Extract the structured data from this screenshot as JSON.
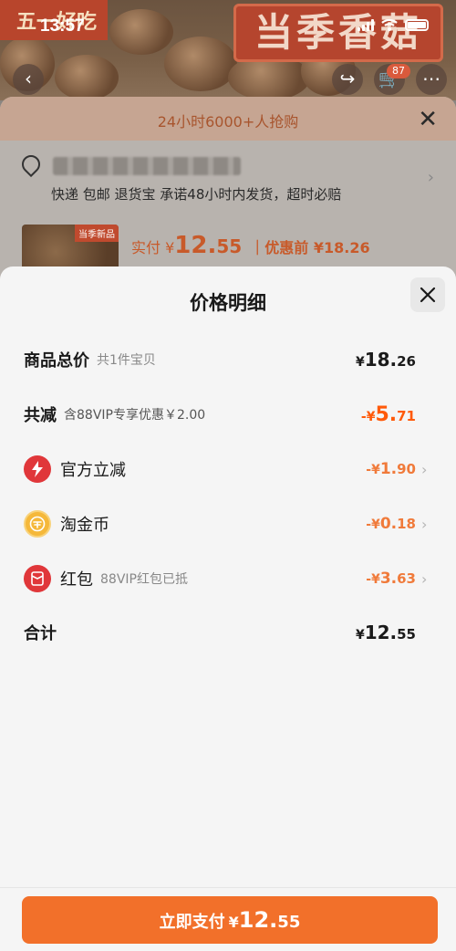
{
  "status": {
    "time": "13:57"
  },
  "background": {
    "banner_left": "五一好吃",
    "banner_right": "当季香菇",
    "cart_badge": "87",
    "hot_text": "24小时6000+人抢购",
    "shipping_text": "快递 包邮 退货宝 承诺48小时内发货，超时必赔",
    "thumb_tag": "当季新品",
    "price_label": "实付 ¥",
    "price_int": "12.",
    "price_dec": "55",
    "before_label": "｜优惠前 ¥18.26"
  },
  "sheet": {
    "title": "价格明细",
    "rows": [
      {
        "label": "商品总价",
        "sub": "共1件宝贝",
        "currency": "¥",
        "int": "18.",
        "dec": "26"
      },
      {
        "label": "共减",
        "sub": "含88VIP专享优惠￥2.00",
        "currency": "-¥",
        "int": "5.",
        "dec": "71"
      },
      {
        "label": "官方立减",
        "sub": "",
        "currency": "-¥",
        "int": "1.",
        "dec": "90",
        "icon": "lightning-icon"
      },
      {
        "label": "淘金币",
        "sub": "",
        "currency": "-¥",
        "int": "0.",
        "dec": "18",
        "icon": "coin-icon"
      },
      {
        "label": "红包",
        "sub": "88VIP红包已抵",
        "currency": "-¥",
        "int": "3.",
        "dec": "63",
        "icon": "red-packet-icon"
      },
      {
        "label": "合计",
        "sub": "",
        "currency": "¥",
        "int": "12.",
        "dec": "55"
      }
    ],
    "pay_button": {
      "label": "立即支付",
      "currency": "¥",
      "int": "12.",
      "dec": "55"
    }
  },
  "colors": {
    "accent": "#f2702a",
    "discount": "#ff5a0a",
    "coin": "#f5b83a",
    "red": "#e0373a"
  }
}
